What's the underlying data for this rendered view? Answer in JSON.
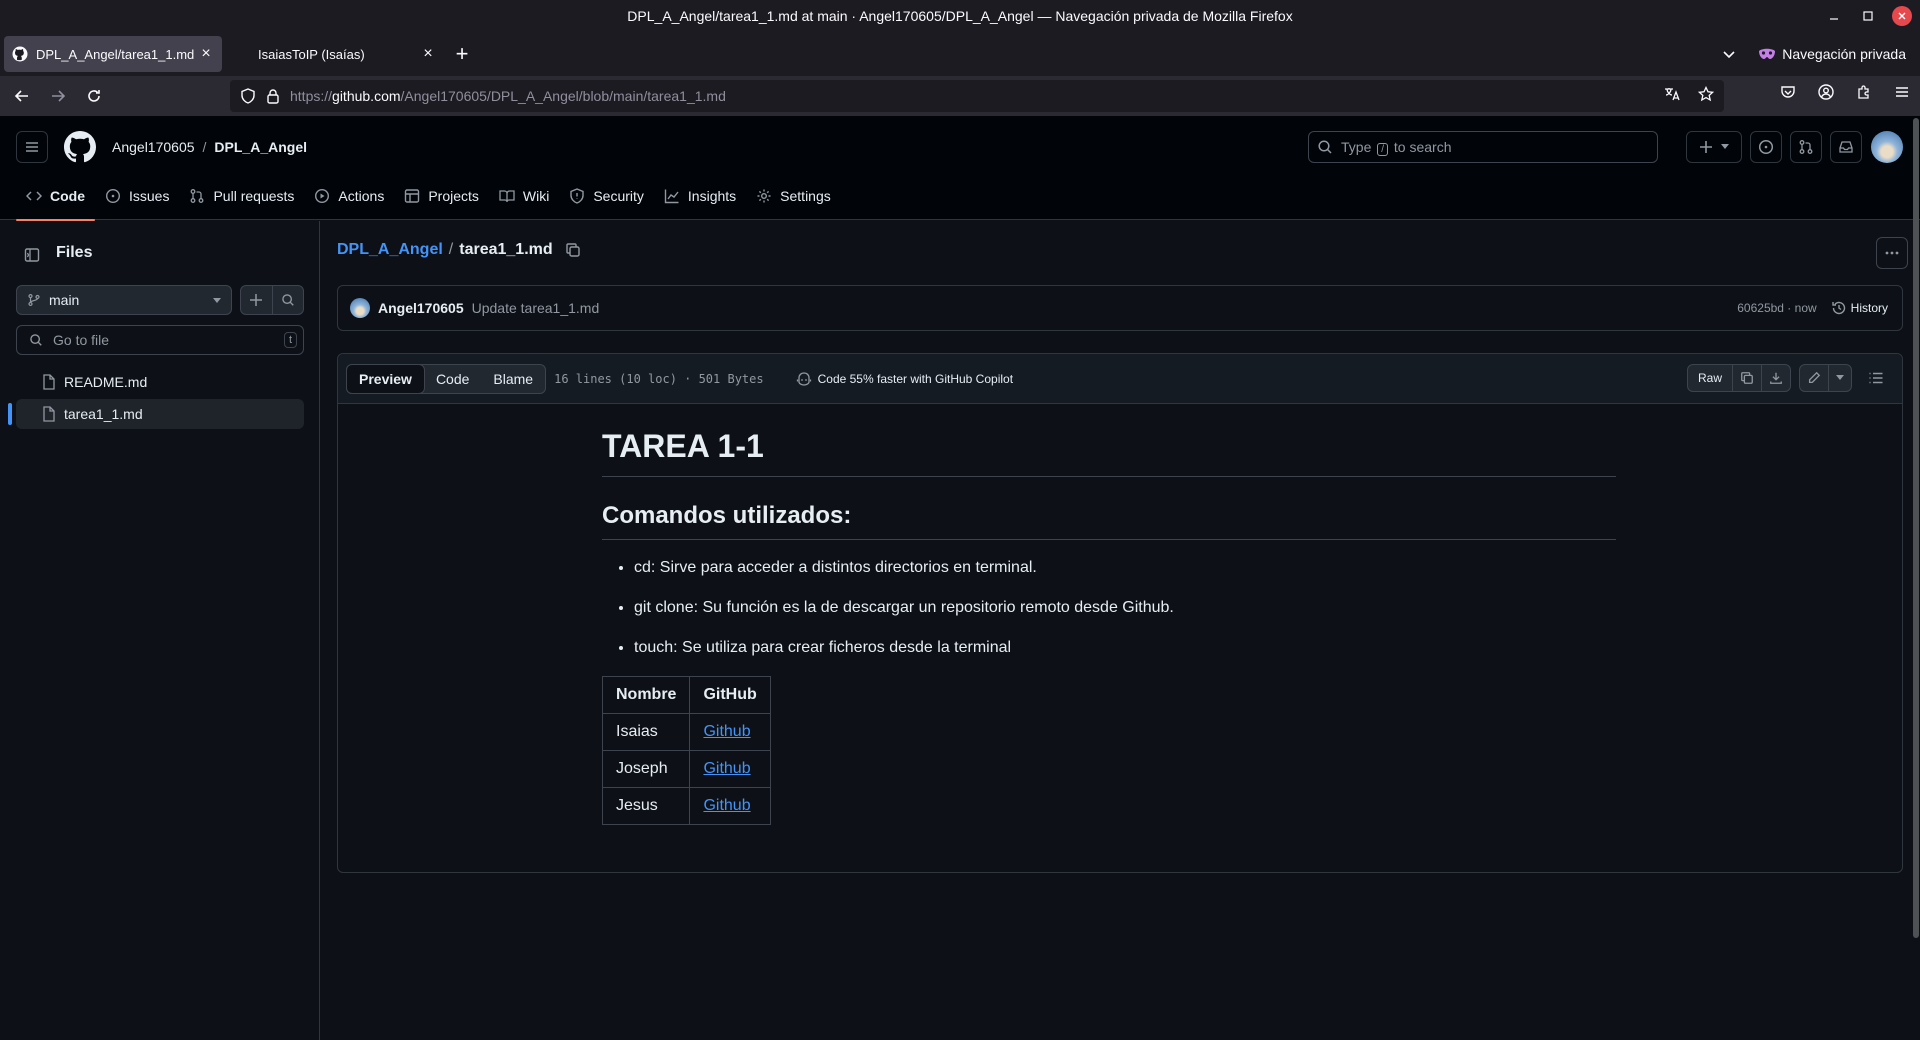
{
  "window": {
    "title": "DPL_A_Angel/tarea1_1.md at main · Angel170605/DPL_A_Angel — Navegación privada de Mozilla Firefox"
  },
  "browser": {
    "tabs": [
      {
        "title": "DPL_A_Angel/tarea1_1.md at main · Angel170605/DPL_A_Angel",
        "active": true
      },
      {
        "title": "IsaiasToIP (Isaías)",
        "active": false
      }
    ],
    "private_label": "Navegación privada",
    "url_prefix": "https://",
    "url_host": "github.com",
    "url_path": "/Angel170605/DPL_A_Angel/blob/main/tarea1_1.md"
  },
  "github": {
    "owner": "Angel170605",
    "repo": "DPL_A_Angel",
    "search_prefix": "Type",
    "search_key": "/",
    "search_suffix": "to search",
    "nav": [
      {
        "label": "Code",
        "icon": "code-icon",
        "selected": true
      },
      {
        "label": "Issues",
        "icon": "issue-icon"
      },
      {
        "label": "Pull requests",
        "icon": "pull-request-icon"
      },
      {
        "label": "Actions",
        "icon": "play-icon"
      },
      {
        "label": "Projects",
        "icon": "table-icon"
      },
      {
        "label": "Wiki",
        "icon": "book-icon"
      },
      {
        "label": "Security",
        "icon": "shield-icon"
      },
      {
        "label": "Insights",
        "icon": "graph-icon"
      },
      {
        "label": "Settings",
        "icon": "gear-icon"
      }
    ]
  },
  "sidebar": {
    "title": "Files",
    "branch": "main",
    "goto_placeholder": "Go to file",
    "goto_key": "t",
    "files": [
      {
        "name": "README.md",
        "selected": false
      },
      {
        "name": "tarea1_1.md",
        "selected": true
      }
    ]
  },
  "file": {
    "repo_link": "DPL_A_Angel",
    "name": "tarea1_1.md",
    "commit": {
      "author": "Angel170605",
      "message": "Update tarea1_1.md",
      "sha": "60625bd",
      "time": "now",
      "history_label": "History"
    },
    "view_tabs": [
      "Preview",
      "Code",
      "Blame"
    ],
    "info": "16 lines (10 loc) · 501 Bytes",
    "copilot": "Code 55% faster with GitHub Copilot",
    "raw_label": "Raw"
  },
  "content": {
    "h1": "TAREA 1-1",
    "h2": "Comandos utilizados:",
    "items": [
      "cd: Sirve para acceder a distintos directorios en terminal.",
      "git clone: Su función es la de descargar un repositorio remoto desde Github.",
      "touch: Se utiliza para crear ficheros desde la terminal"
    ],
    "table": {
      "headers": [
        "Nombre",
        "GitHub"
      ],
      "rows": [
        [
          "Isaias",
          "Github"
        ],
        [
          "Joseph",
          "Github"
        ],
        [
          "Jesus",
          "Github"
        ]
      ]
    }
  },
  "colors": {
    "background": "#0d1117",
    "header": "#010409",
    "accent_link": "#4493f8",
    "selected_tab_underline": "#f78166"
  }
}
